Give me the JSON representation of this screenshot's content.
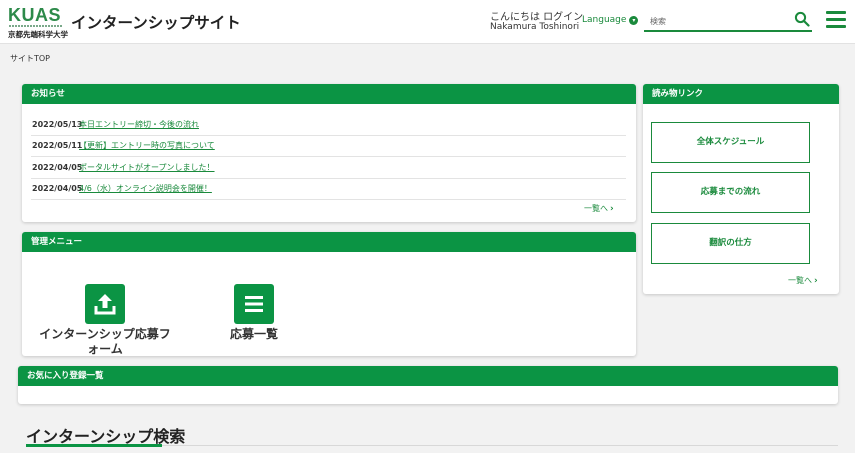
{
  "header": {
    "logo_text": "KUAS",
    "logo_subtitle": "京都先端科学大学",
    "site_title": "インターンシップサイト",
    "greeting": "こんにちは ログイン",
    "user_name": "Nakamura Toshinori",
    "language_label": "Language",
    "search_placeholder": "検索",
    "accent_color": "#0b9444"
  },
  "breadcrumb": "サイトTOP",
  "news": {
    "title": "お知らせ",
    "items": [
      {
        "date": "2022/05/13",
        "text": "本日エントリー締切・今後の流れ"
      },
      {
        "date": "2022/05/11",
        "text": "【更新】エントリー時の写真について"
      },
      {
        "date": "2022/04/05",
        "text": "ポータルサイトがオープンしました！"
      },
      {
        "date": "2022/04/05",
        "text": "4/6（水）オンライン説明会を開催！"
      }
    ],
    "more": "一覧へ"
  },
  "admin_menu": {
    "title": "管理メニュー",
    "tiles": [
      {
        "label_line1": "インターンシップ応募フ",
        "label_line2": "ォーム",
        "icon": "upload-icon"
      },
      {
        "label_line1": "応募一覧",
        "icon": "list-icon"
      }
    ]
  },
  "reading_links": {
    "title": "読み物リンク",
    "buttons": [
      "全体スケジュール",
      "応募までの流れ",
      "翻訳の仕方"
    ],
    "more": "一覧へ"
  },
  "favorites": {
    "title": "お気に入り登録一覧"
  },
  "internship_search": {
    "title": "インターンシップ検索"
  }
}
